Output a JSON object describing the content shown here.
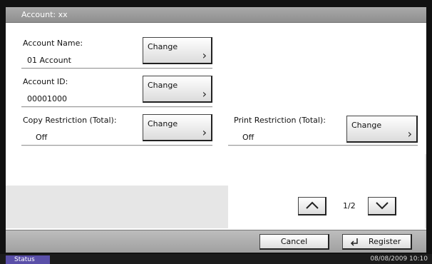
{
  "header": {
    "title": "Account: xx"
  },
  "fields": {
    "account_name": {
      "label": "Account Name:",
      "value": "01 Account",
      "button": "Change"
    },
    "account_id": {
      "label": "Account ID:",
      "value": "00001000",
      "button": "Change"
    },
    "copy_restriction": {
      "label": "Copy Restriction (Total):",
      "value": "Off",
      "button": "Change"
    },
    "print_restriction": {
      "label": "Print Restriction (Total):",
      "value": "Off",
      "button": "Change"
    }
  },
  "pagination": {
    "indicator": "1/2"
  },
  "footer": {
    "cancel": "Cancel",
    "register": "Register"
  },
  "statusbar": {
    "status": "Status",
    "datetime": "08/08/2009  10:10"
  },
  "colors": {
    "status_tab": "#5a4fa8",
    "title_bar": "#9a9a9a"
  }
}
